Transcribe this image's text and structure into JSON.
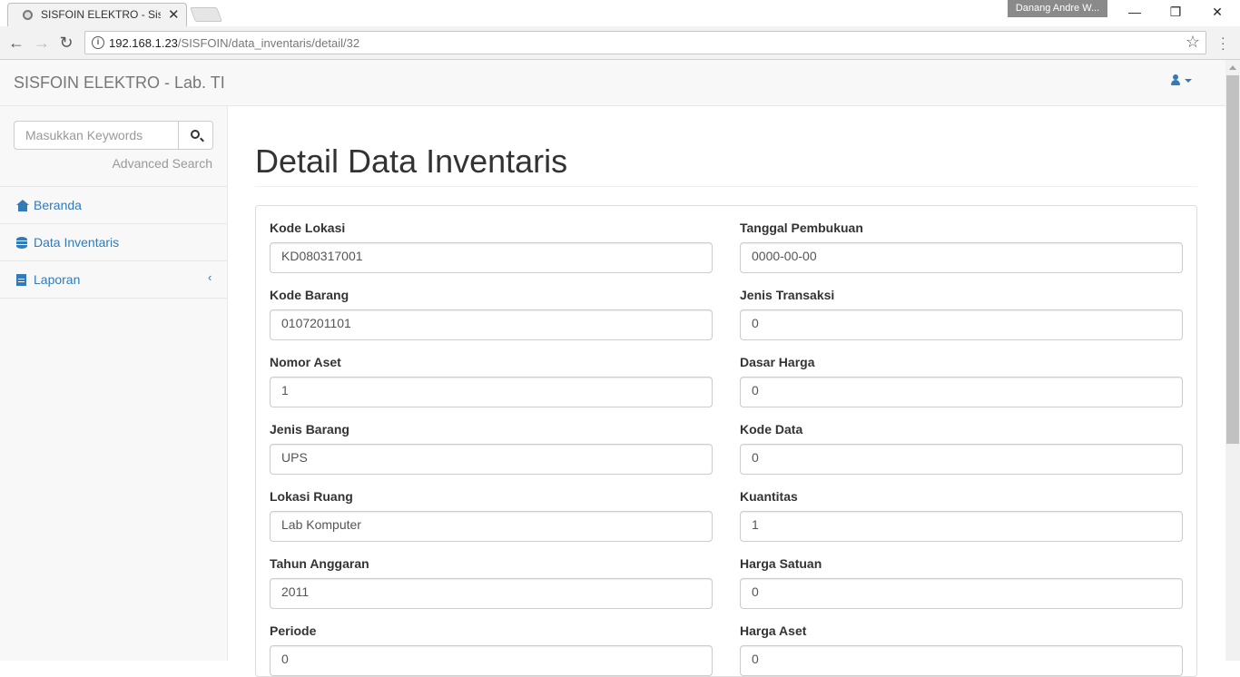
{
  "browser": {
    "tab_title": "SISFOIN ELEKTRO - Sistem",
    "profile_name": "Danang Andre W...",
    "url_host": "192.168.1.23",
    "url_path": "/SISFOIN/data_inventaris/detail/32"
  },
  "navbar": {
    "brand": "SISFOIN ELEKTRO - Lab. TI"
  },
  "sidebar": {
    "search_placeholder": "Masukkan Keywords",
    "advanced_search": "Advanced Search",
    "items": [
      {
        "label": "Beranda",
        "icon": "home-icon"
      },
      {
        "label": "Data Inventaris",
        "icon": "database-icon"
      },
      {
        "label": "Laporan",
        "icon": "file-icon"
      }
    ]
  },
  "main": {
    "title": "Detail Data Inventaris",
    "left_fields": [
      {
        "label": "Kode Lokasi",
        "value": "KD080317001"
      },
      {
        "label": "Kode Barang",
        "value": "0107201101"
      },
      {
        "label": "Nomor Aset",
        "value": "1"
      },
      {
        "label": "Jenis Barang",
        "value": "UPS"
      },
      {
        "label": "Lokasi Ruang",
        "value": "Lab Komputer"
      },
      {
        "label": "Tahun Anggaran",
        "value": "2011"
      },
      {
        "label": "Periode",
        "value": "0"
      }
    ],
    "right_fields": [
      {
        "label": "Tanggal Pembukuan",
        "value": "0000-00-00"
      },
      {
        "label": "Jenis Transaksi",
        "value": "0"
      },
      {
        "label": "Dasar Harga",
        "value": "0"
      },
      {
        "label": "Kode Data",
        "value": "0"
      },
      {
        "label": "Kuantitas",
        "value": "1"
      },
      {
        "label": "Harga Satuan",
        "value": "0"
      },
      {
        "label": "Harga Aset",
        "value": "0"
      }
    ]
  },
  "colors": {
    "link": "#337ab7",
    "navbar_bg": "#f8f8f8"
  }
}
